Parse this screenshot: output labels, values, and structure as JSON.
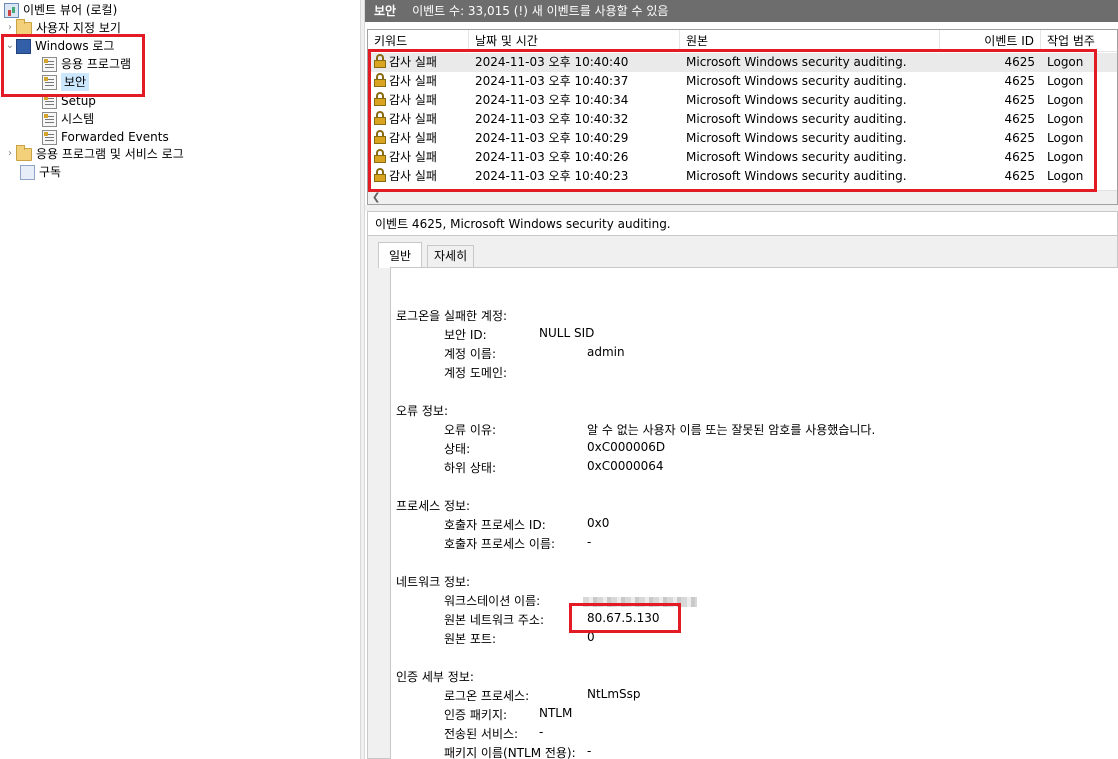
{
  "tree": {
    "root_label": "이벤트 뷰어 (로컬)",
    "custom_views_label": "사용자 지정 보기",
    "windows_logs_label": "Windows 로그",
    "logs": [
      "응용 프로그램",
      "보안",
      "Setup",
      "시스템",
      "Forwarded Events"
    ],
    "selected_log": "보안",
    "apps_services_label": "응용 프로그램 및 서비스 로그",
    "subscriptions_label": "구독"
  },
  "header": {
    "log_name": "보안",
    "status_text": "이벤트 수: 33,015 (!) 새 이벤트를 사용할 수 있음"
  },
  "event_list": {
    "columns": [
      "키워드",
      "날짜 및 시간",
      "원본",
      "이벤트 ID",
      "작업 범주"
    ],
    "rows": [
      {
        "keyword": "감사 실패",
        "datetime": "2024-11-03 오후 10:40:40",
        "source": "Microsoft Windows security auditing.",
        "event_id": "4625",
        "category": "Logon"
      },
      {
        "keyword": "감사 실패",
        "datetime": "2024-11-03 오후 10:40:37",
        "source": "Microsoft Windows security auditing.",
        "event_id": "4625",
        "category": "Logon"
      },
      {
        "keyword": "감사 실패",
        "datetime": "2024-11-03 오후 10:40:34",
        "source": "Microsoft Windows security auditing.",
        "event_id": "4625",
        "category": "Logon"
      },
      {
        "keyword": "감사 실패",
        "datetime": "2024-11-03 오후 10:40:32",
        "source": "Microsoft Windows security auditing.",
        "event_id": "4625",
        "category": "Logon"
      },
      {
        "keyword": "감사 실패",
        "datetime": "2024-11-03 오후 10:40:29",
        "source": "Microsoft Windows security auditing.",
        "event_id": "4625",
        "category": "Logon"
      },
      {
        "keyword": "감사 실패",
        "datetime": "2024-11-03 오후 10:40:26",
        "source": "Microsoft Windows security auditing.",
        "event_id": "4625",
        "category": "Logon"
      },
      {
        "keyword": "감사 실패",
        "datetime": "2024-11-03 오후 10:40:23",
        "source": "Microsoft Windows security auditing.",
        "event_id": "4625",
        "category": "Logon"
      }
    ]
  },
  "detail": {
    "title": "이벤트 4625, Microsoft Windows security auditing.",
    "tabs": [
      "일반",
      "자세히"
    ],
    "active_tab": "일반",
    "sections": {
      "account": {
        "heading": "로그온을 실패한 계정:",
        "sid_label": "보안 ID:",
        "sid_value": "NULL SID",
        "name_label": "계정 이름:",
        "name_value": "admin",
        "domain_label": "계정 도메인:"
      },
      "failure": {
        "heading": "오류 정보:",
        "reason_label": "오류 이유:",
        "reason_value": "알 수 없는 사용자 이름 또는 잘못된 암호를 사용했습니다.",
        "status_label": "상태:",
        "status_value": "0xC000006D",
        "substatus_label": "하위 상태:",
        "substatus_value": "0xC0000064"
      },
      "process": {
        "heading": "프로세스 정보:",
        "pid_label": "호출자 프로세스 ID:",
        "pid_value": "0x0",
        "pname_label": "호출자 프로세스 이름:",
        "pname_value": "-"
      },
      "network": {
        "heading": "네트워크 정보:",
        "ws_label": "워크스테이션 이름:",
        "addr_label": "원본 네트워크 주소:",
        "addr_value": "80.67.5.130",
        "port_label": "원본 포트:",
        "port_value": "0"
      },
      "auth": {
        "heading": "인증 세부 정보:",
        "logon_proc_label": "로그온 프로세스:",
        "logon_proc_value": "NtLmSsp",
        "auth_pkg_label": "인증 패키지:",
        "auth_pkg_value": "NTLM",
        "transited_label": "전송된 서비스:",
        "transited_value": "-",
        "pkg_name_label": "패키지 이름(NTLM 전용):",
        "pkg_name_value": "-"
      }
    }
  },
  "colors": {
    "highlight_box": "#e21b24",
    "header_bar": "#6d6d6d",
    "selection": "#cce8ff"
  }
}
